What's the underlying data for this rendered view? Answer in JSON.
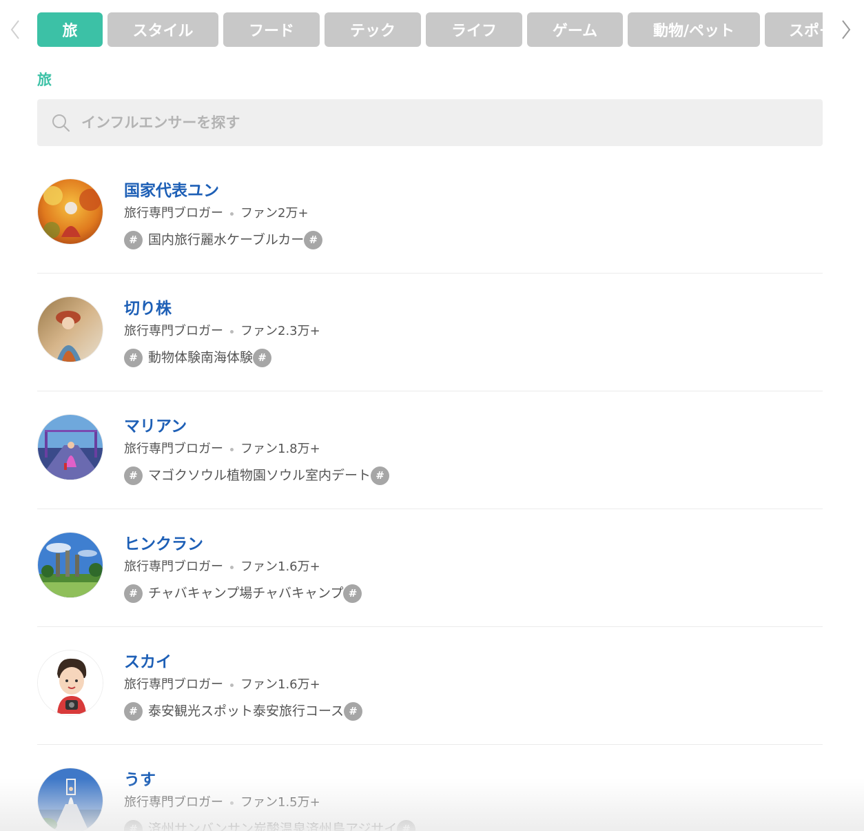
{
  "tabs": [
    {
      "label": "旅",
      "active": true
    },
    {
      "label": "スタイル",
      "active": false
    },
    {
      "label": "フード",
      "active": false
    },
    {
      "label": "テック",
      "active": false
    },
    {
      "label": "ライフ",
      "active": false
    },
    {
      "label": "ゲーム",
      "active": false
    },
    {
      "label": "動物/ペット",
      "active": false
    },
    {
      "label": "スポーツ",
      "active": false
    }
  ],
  "section_title": "旅",
  "search": {
    "placeholder": "インフルエンサーを探す"
  },
  "influencers": [
    {
      "name": "国家代表ユン",
      "category": "旅行専門ブロガー",
      "fans": "ファン2万+",
      "tags": "国内旅行麗水ケーブルカー"
    },
    {
      "name": "切り株",
      "category": "旅行専門ブロガー",
      "fans": "ファン2.3万+",
      "tags": "動物体験南海体験"
    },
    {
      "name": "マリアン",
      "category": "旅行専門ブロガー",
      "fans": "ファン1.8万+",
      "tags": "マゴクソウル植物園ソウル室内デート"
    },
    {
      "name": "ヒンクラン",
      "category": "旅行専門ブロガー",
      "fans": "ファン1.6万+",
      "tags": "チャバキャンプ場チャバキャンプ"
    },
    {
      "name": "スカイ",
      "category": "旅行専門ブロガー",
      "fans": "ファン1.6万+",
      "tags": "泰安観光スポット泰安旅行コース"
    },
    {
      "name": "うす",
      "category": "旅行専門ブロガー",
      "fans": "ファン1.5万+",
      "tags": "済州サンバンサン炭酸温泉済州島アジサイ"
    }
  ],
  "colors": {
    "accent": "#3cc1a6",
    "name": "#1d5fb6",
    "tab_inactive": "#c8c8c8",
    "hash": "#a6a6a6"
  },
  "icons": {
    "prev": "chevron-left-icon",
    "next": "chevron-right-icon",
    "search": "search-icon",
    "tag": "hashtag-icon"
  }
}
